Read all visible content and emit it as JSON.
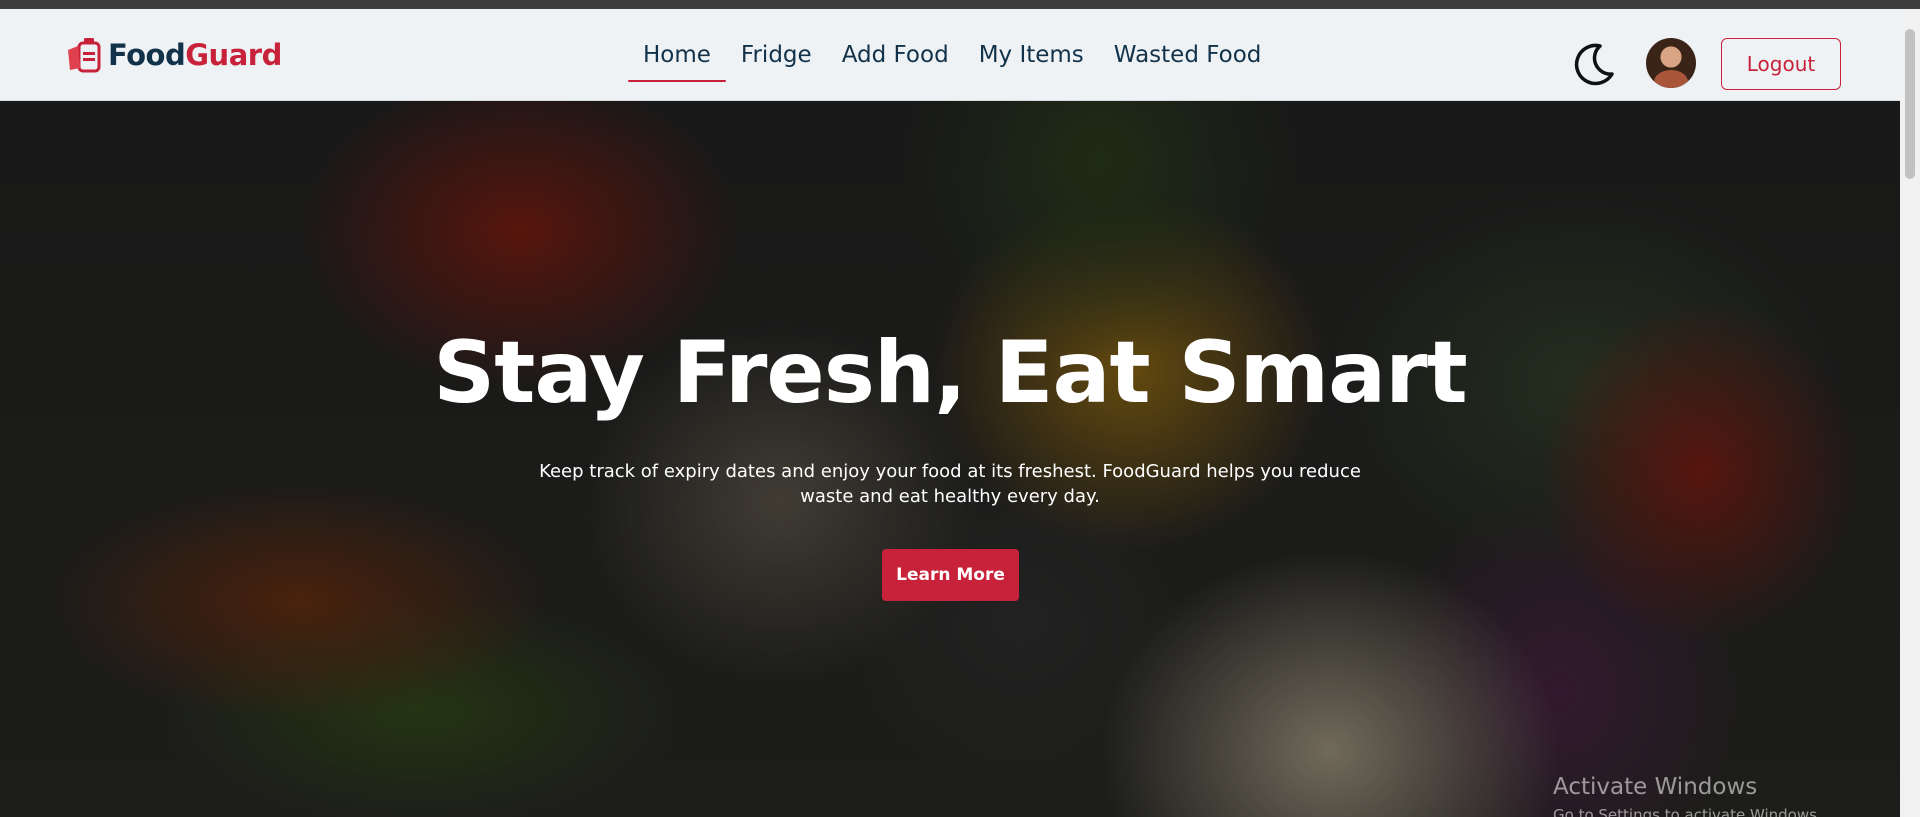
{
  "brand": {
    "food": "Food",
    "guard": "Guard"
  },
  "nav": {
    "links": [
      {
        "label": "Home"
      },
      {
        "label": "Fridge"
      },
      {
        "label": "Add Food"
      },
      {
        "label": "My Items"
      },
      {
        "label": "Wasted Food"
      }
    ],
    "active": "Home"
  },
  "header": {
    "logout_label": "Logout",
    "theme_icon": "moon-icon"
  },
  "hero": {
    "title": "Stay Fresh, Eat Smart",
    "subtitle": "Keep track of expiry dates and enjoy your food at its freshest. FoodGuard helps you reduce waste and eat healthy every day.",
    "cta_label": "Learn More"
  },
  "watermark": {
    "title": "Activate Windows",
    "subtitle": "Go to Settings to activate Windows."
  },
  "colors": {
    "accent": "#c8223a",
    "navy": "#12324a",
    "nav_bg": "#eef2f5"
  }
}
